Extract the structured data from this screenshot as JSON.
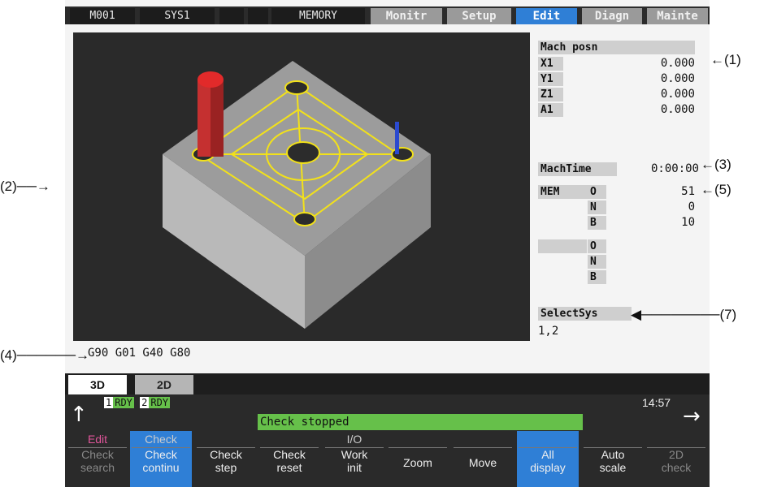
{
  "topbar": {
    "slot1": "M001",
    "slot2": "SYS1",
    "slot3": "",
    "slot4": "",
    "slot5": "MEMORY",
    "modes": [
      "Monitr",
      "Setup",
      "Edit",
      "Diagn",
      "Mainte"
    ],
    "active_mode": "Edit"
  },
  "right_panel": {
    "mach_posn_title": "Mach posn",
    "axes": [
      {
        "name": "X1",
        "value": "0.000"
      },
      {
        "name": "Y1",
        "value": "0.000"
      },
      {
        "name": "Z1",
        "value": "0.000"
      },
      {
        "name": "A1",
        "value": "0.000"
      }
    ],
    "mach_time_label": "MachTime",
    "mach_time_value": "0:00:00",
    "mem_label": "MEM",
    "mem_rows": [
      {
        "label": "O",
        "value": "51"
      },
      {
        "label": "N",
        "value": "0"
      },
      {
        "label": "B",
        "value": "10"
      },
      {
        "label": "O",
        "value": ""
      },
      {
        "label": "N",
        "value": ""
      },
      {
        "label": "B",
        "value": ""
      }
    ],
    "select_sys_label": "SelectSys",
    "select_sys_value": "1,2"
  },
  "modal_text": "G90 G01 G40 G80",
  "tabs": {
    "t3d": "3D",
    "t2d": "2D"
  },
  "status": {
    "rdy1_num": "1",
    "rdy1": "RDY",
    "rdy2_num": "2",
    "rdy2": "RDY",
    "time": "14:57",
    "message": "Check stopped"
  },
  "menus": [
    {
      "top": "Edit",
      "line1": "Check",
      "line2": "search",
      "selected": false,
      "dim": true
    },
    {
      "top": "Check",
      "line1": "Check",
      "line2": "continu",
      "selected": true,
      "dim": false
    },
    {
      "top": "",
      "line1": "Check",
      "line2": "step",
      "selected": false,
      "dim": false
    },
    {
      "top": "",
      "line1": "Check",
      "line2": "reset",
      "selected": false,
      "dim": false
    },
    {
      "top": "I/O",
      "line1": "Work",
      "line2": "init",
      "selected": false,
      "dim": false
    },
    {
      "top": "",
      "line1": "Zoom",
      "line2": "",
      "selected": false,
      "dim": false
    },
    {
      "top": "",
      "line1": "Move",
      "line2": "",
      "selected": false,
      "dim": false
    },
    {
      "top": "",
      "line1": "All",
      "line2": "display",
      "selected": true,
      "dim": false
    },
    {
      "top": "",
      "line1": "Auto",
      "line2": "scale",
      "selected": false,
      "dim": false
    },
    {
      "top": "",
      "line1": "2D",
      "line2": "check",
      "selected": false,
      "dim": true
    }
  ],
  "callouts": {
    "c1": "(1)",
    "c2": "(2)",
    "c3": "(3)",
    "c4": "(4)",
    "c5": "(5)",
    "c7": "(7)"
  },
  "colors": {
    "accent": "#2f7fd6",
    "status_green": "#66c04a",
    "path_yellow": "#f2e11a",
    "tool_red": "#e22a2a"
  }
}
